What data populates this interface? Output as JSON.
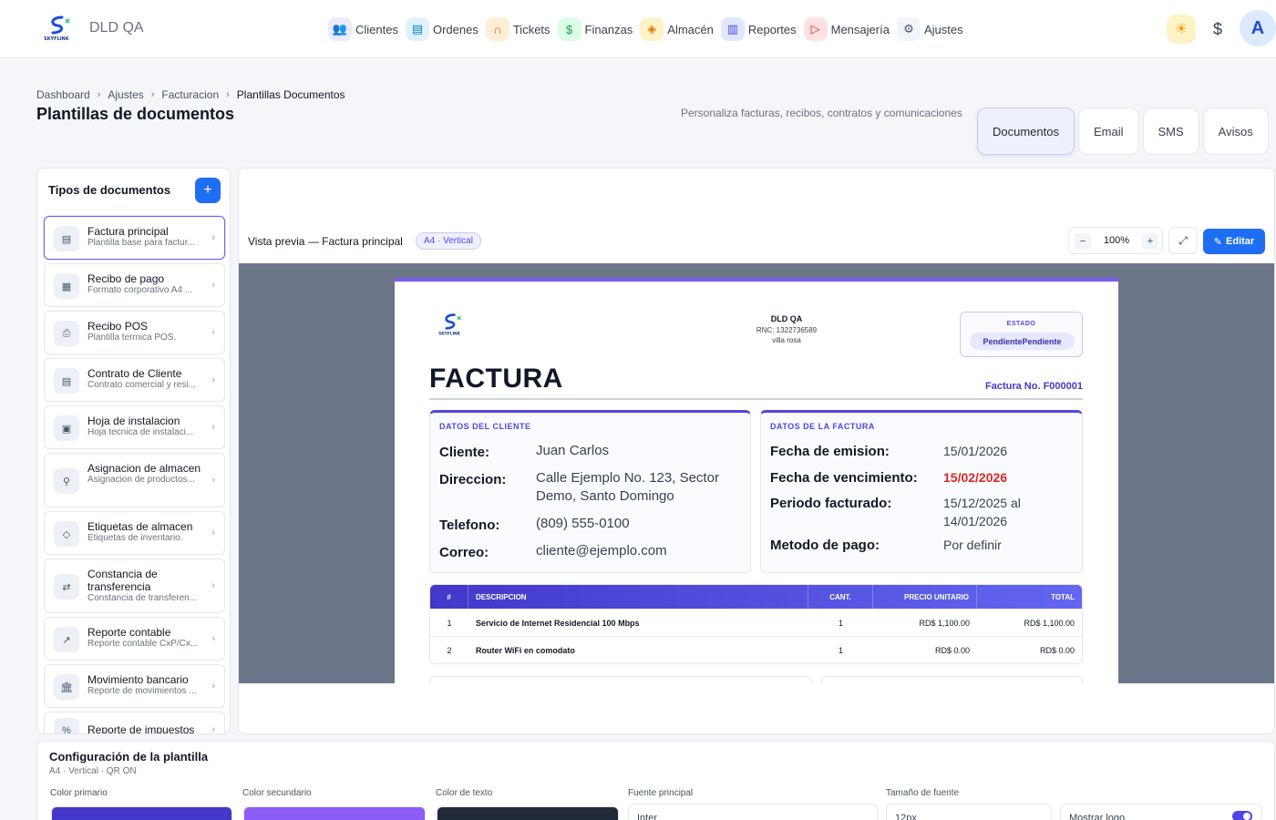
{
  "app": {
    "name": "DLD QA",
    "logo_text": "SKYFLINK"
  },
  "nav": [
    {
      "label": "Clientes",
      "icon": "users-icon",
      "bg": "#ede9fe",
      "fg": "#7c3aed",
      "glyph": "👥"
    },
    {
      "label": "Ordenes",
      "icon": "file-text-icon",
      "bg": "#e0f2fe",
      "fg": "#0284c7",
      "glyph": "▤"
    },
    {
      "label": "Tickets",
      "icon": "headset-icon",
      "bg": "#ffedd5",
      "fg": "#ea580c",
      "glyph": "∩"
    },
    {
      "label": "Finanzas",
      "icon": "dollar-icon",
      "bg": "#dcfce7",
      "fg": "#16a34a",
      "glyph": "$"
    },
    {
      "label": "Almacén",
      "icon": "box-icon",
      "bg": "#fef3c7",
      "fg": "#d97706",
      "glyph": "◈"
    },
    {
      "label": "Reportes",
      "icon": "bar-chart-icon",
      "bg": "#e0e7ff",
      "fg": "#4f46e5",
      "glyph": "▥"
    },
    {
      "label": "Mensajería",
      "icon": "send-icon",
      "bg": "#fee2e2",
      "fg": "#dc2626",
      "glyph": "▷"
    },
    {
      "label": "Ajustes",
      "icon": "gear-icon",
      "bg": "#f1f5f9",
      "fg": "#475569",
      "glyph": "⚙"
    }
  ],
  "header_actions": {
    "sun_icon": "☀",
    "dollar_icon": "$",
    "avatar_letter": "A"
  },
  "breadcrumb": [
    "Dashboard",
    "Ajustes",
    "Facturacion",
    "Plantillas Documentos"
  ],
  "page": {
    "title": "Plantillas de documentos",
    "subtitle": "Personaliza facturas, recibos, contratos y comunicaciones"
  },
  "tabs": [
    {
      "label": "Documentos",
      "active": true
    },
    {
      "label": "Email",
      "active": false
    },
    {
      "label": "SMS",
      "active": false
    },
    {
      "label": "Avisos",
      "active": false
    }
  ],
  "sidebar": {
    "title": "Tipos de documentos",
    "add_label": "+",
    "items": [
      {
        "title": "Factura principal",
        "subtitle": "Plantilla base para factur...",
        "icon": "file-icon",
        "glyph": "▤",
        "active": true
      },
      {
        "title": "Recibo de pago",
        "subtitle": "Formato corporativo A4 ...",
        "icon": "receipt-icon",
        "glyph": "▦",
        "active": false
      },
      {
        "title": "Recibo POS",
        "subtitle": "Plantilla termica POS.",
        "icon": "printer-icon",
        "glyph": "⎙",
        "active": false
      },
      {
        "title": "Contrato de Cliente",
        "subtitle": "Contrato comercial y resi...",
        "icon": "contract-icon",
        "glyph": "▤",
        "active": false
      },
      {
        "title": "Hoja de instalacion",
        "subtitle": "Hoja tecnica de instalaci...",
        "icon": "clipboard-icon",
        "glyph": "▣",
        "active": false
      },
      {
        "title": "Asignacion de almacen",
        "subtitle": "Asignacion de productos...",
        "icon": "user-check-icon",
        "glyph": "⚲",
        "active": false
      },
      {
        "title": "Etiquetas de almacen",
        "subtitle": "Etiquetas de inventario.",
        "icon": "tag-icon",
        "glyph": "◇",
        "active": false
      },
      {
        "title": "Constancia de transferencia",
        "subtitle": "Constancia de transferen...",
        "icon": "transfer-icon",
        "glyph": "⇄",
        "active": false
      },
      {
        "title": "Reporte contable",
        "subtitle": "Reporte contable CxP/Cx...",
        "icon": "line-chart-icon",
        "glyph": "↗",
        "active": false
      },
      {
        "title": "Movimiento bancario",
        "subtitle": "Reporte de movimientos ...",
        "icon": "bank-icon",
        "glyph": "🏛",
        "active": false
      },
      {
        "title": "Reporte de impuestos",
        "subtitle": "",
        "icon": "tax-icon",
        "glyph": "%",
        "active": false
      }
    ]
  },
  "preview": {
    "title": "Vista previa — Factura principal",
    "badge": "A4 · Vertical",
    "zoom": "100%",
    "zoom_out": "−",
    "zoom_in": "+",
    "expand_icon": "⤢",
    "edit_label": "Editar",
    "edit_icon": "✎"
  },
  "invoice": {
    "company": "DLD QA",
    "rnc": "RNC: 1322736589",
    "address": "villa rosa",
    "estado_label": "ESTADO",
    "estado_value": "PendientePendiente",
    "title": "FACTURA",
    "number": "Factura No. F000001",
    "client_heading": "DATOS DEL CLIENTE",
    "client": [
      {
        "k": "Cliente:",
        "v": "Juan Carlos"
      },
      {
        "k": "Direccion:",
        "v": "Calle Ejemplo No. 123, Sector Demo, Santo Domingo"
      },
      {
        "k": "Telefono:",
        "v": "(809) 555-0100"
      },
      {
        "k": "Correo:",
        "v": "cliente@ejemplo.com"
      }
    ],
    "invoice_heading": "DATOS DE LA FACTURA",
    "details": [
      {
        "k": "Fecha de emision:",
        "v": "15/01/2026"
      },
      {
        "k": "Fecha de vencimiento:",
        "v": "15/02/2026"
      },
      {
        "k": "Periodo facturado:",
        "v": "15/12/2025 al 14/01/2026"
      },
      {
        "k": "Metodo de pago:",
        "v": "Por definir"
      }
    ],
    "due_color": "#dc2626",
    "table_headers": [
      "#",
      "DESCRIPCION",
      "CANT.",
      "PRECIO UNITARIO",
      "TOTAL"
    ],
    "rows": [
      {
        "n": "1",
        "desc": "Servicio de Internet Residencial 100 Mbps",
        "qty": "1",
        "price": "RD$ 1,100.00",
        "total": "RD$ 1,100.00"
      },
      {
        "n": "2",
        "desc": "Router WiFi en comodato",
        "qty": "1",
        "price": "RD$ 0.00",
        "total": "RD$ 0.00"
      }
    ]
  },
  "config": {
    "title": "Configuración de la plantilla",
    "subtitle": "A4 · Vertical · QR ON",
    "primary_label": "Color primario",
    "primary_color": "#4338ca",
    "secondary_label": "Color secundario",
    "secondary_color": "#8b5cf6",
    "text_label": "Color de texto",
    "text_color": "#1f2937",
    "font_label": "Fuente principal",
    "font_value": "Inter",
    "size_label": "Tamaño de fuente",
    "size_value": "12px",
    "logo_label": "Mostrar logo"
  }
}
